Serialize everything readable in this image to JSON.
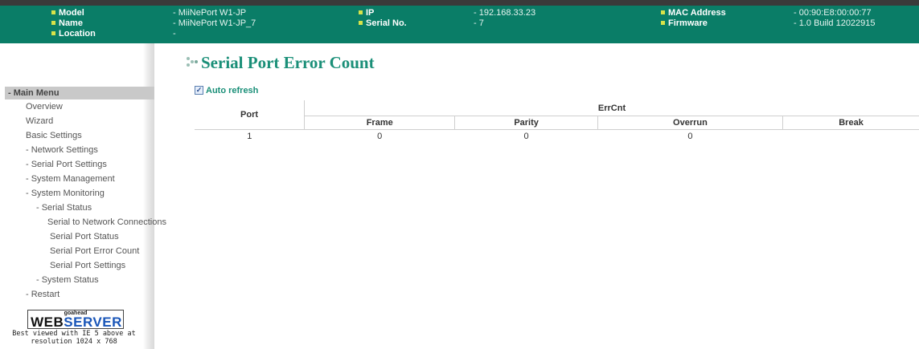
{
  "header": {
    "model_label": "Model",
    "model_value": "- MiiNePort W1-JP",
    "name_label": "Name",
    "name_value": "- MiiNePort W1-JP_7",
    "location_label": "Location",
    "location_value": "-",
    "ip_label": "IP",
    "ip_value": "- 192.168.33.23",
    "serial_label": "Serial No.",
    "serial_value": "- 7",
    "mac_label": "MAC Address",
    "mac_value": "- 00:90:E8:00:00:77",
    "firmware_label": "Firmware",
    "firmware_value": "- 1.0 Build 12022915"
  },
  "menu": {
    "header": "- Main Menu",
    "items": [
      "Overview",
      "Wizard",
      "Basic Settings",
      "- Network Settings",
      "- Serial Port Settings",
      "- System Management",
      "- System Monitoring",
      "- Serial Status",
      "Serial to Network Connections",
      "Serial Port Status",
      "Serial Port Error Count",
      "Serial Port Settings",
      "- System Status",
      "- Restart"
    ]
  },
  "logo": {
    "small": "goahead",
    "web": "WEB",
    "server": "SERVER",
    "caption_line1": "Best viewed with IE 5 above at",
    "caption_line2": "resolution 1024 x 768"
  },
  "main": {
    "title": "Serial Port Error Count",
    "auto_refresh_label": "Auto refresh",
    "auto_refresh_checked": true
  },
  "table": {
    "port_header": "Port",
    "group_header": "ErrCnt",
    "columns": [
      "Frame",
      "Parity",
      "Overrun",
      "Break"
    ],
    "rows": [
      {
        "port": "1",
        "frame": "0",
        "parity": "0",
        "overrun": "0",
        "break": ""
      }
    ]
  },
  "colors": {
    "header_bg": "#0a7d67",
    "title": "#1a8f78",
    "bullet": "#d7e34a"
  }
}
